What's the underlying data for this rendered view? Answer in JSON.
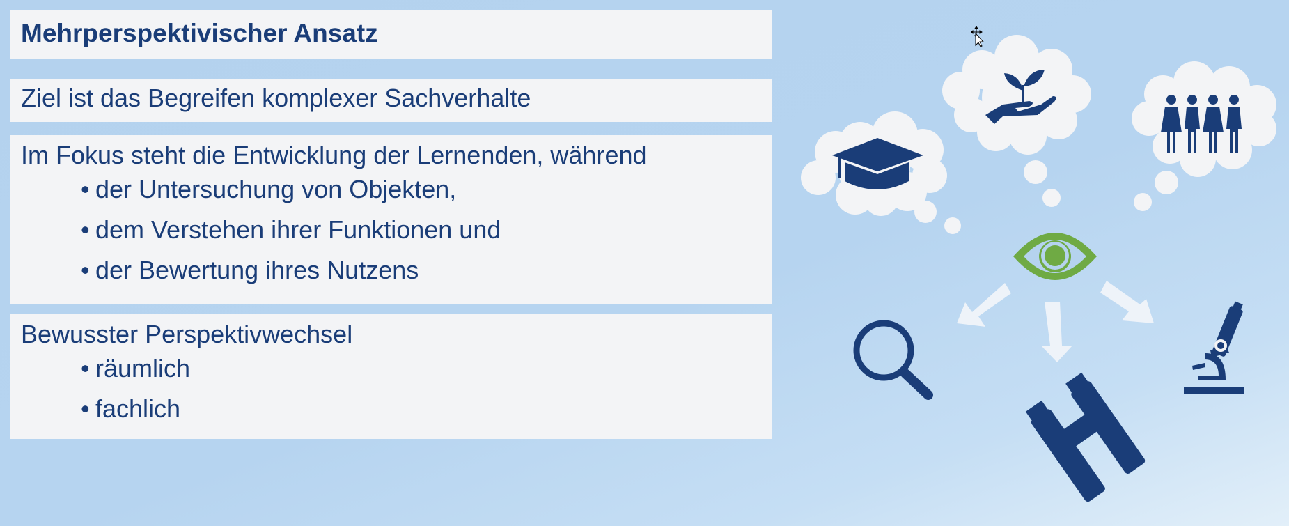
{
  "slide": {
    "title": "Mehrperspektivischer Ansatz",
    "goal": "Ziel ist das Begreifen komplexer Sachverhalte",
    "focus": {
      "intro": "Im Fokus steht die Entwicklung der Lernenden, während",
      "items": [
        "der Untersuchung von Objekten,",
        "dem Verstehen ihrer Funktionen und",
        "der Bewertung ihres Nutzens"
      ]
    },
    "change": {
      "intro": "Bewusster Perspektivwechsel",
      "items": [
        "räumlich",
        "fachlich"
      ]
    },
    "bullet_glyph": "•"
  },
  "visual": {
    "icons": [
      "graduation-cap-icon",
      "hand-plant-icon",
      "people-group-icon",
      "eye-icon",
      "magnifier-icon",
      "binoculars-icon",
      "microscope-icon"
    ],
    "colors": {
      "navy": "#1a3d78",
      "green": "#6faa44",
      "cloud": "#f3f4f6",
      "arrow": "#eef3f9"
    }
  }
}
